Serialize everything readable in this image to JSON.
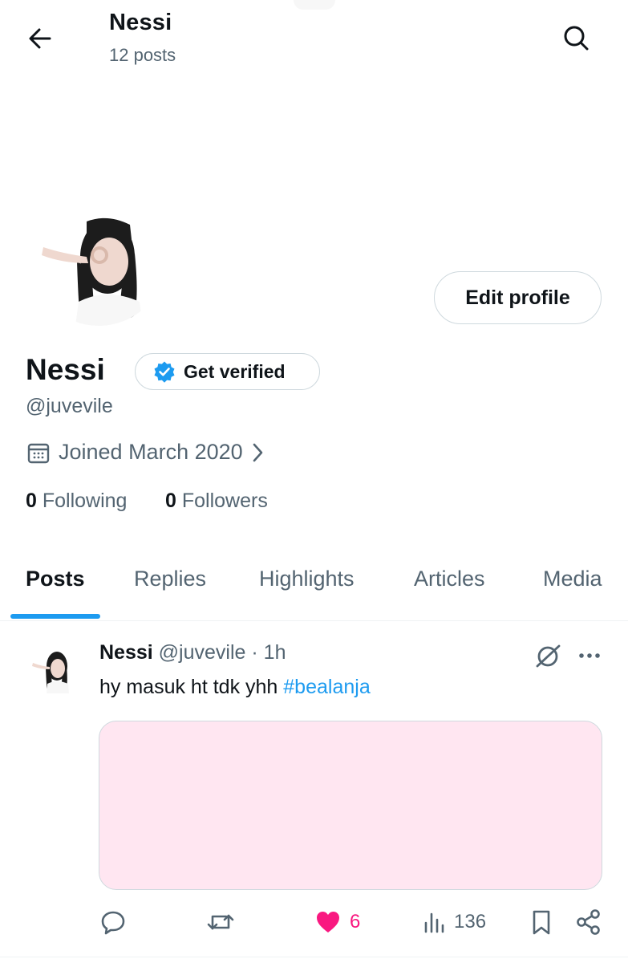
{
  "header": {
    "title": "Nessi",
    "posts_count": "12 posts",
    "back_icon": "arrow-left-icon",
    "search_icon": "search-icon"
  },
  "profile": {
    "name": "Nessi",
    "handle": "@juvevile",
    "edit_label": "Edit profile",
    "verify_label": "Get verified",
    "joined": "Joined March 2020",
    "following_count": "0",
    "following_label": "Following",
    "followers_count": "0",
    "followers_label": "Followers"
  },
  "tabs": [
    {
      "label": "Posts",
      "active": true
    },
    {
      "label": "Replies",
      "active": false
    },
    {
      "label": "Highlights",
      "active": false
    },
    {
      "label": "Articles",
      "active": false
    },
    {
      "label": "Media",
      "active": false
    }
  ],
  "post": {
    "author_name": "Nessi",
    "author_handle": "@juvevile",
    "separator": "·",
    "time": "1h",
    "text": "hy masuk ht tdk yhh",
    "hashtag": "#bealanja",
    "likes": "6",
    "views": "136"
  },
  "colors": {
    "accent": "#1d9bf0",
    "like": "#f91880",
    "muted": "#536471",
    "media_bg": "#ffe6f1"
  }
}
